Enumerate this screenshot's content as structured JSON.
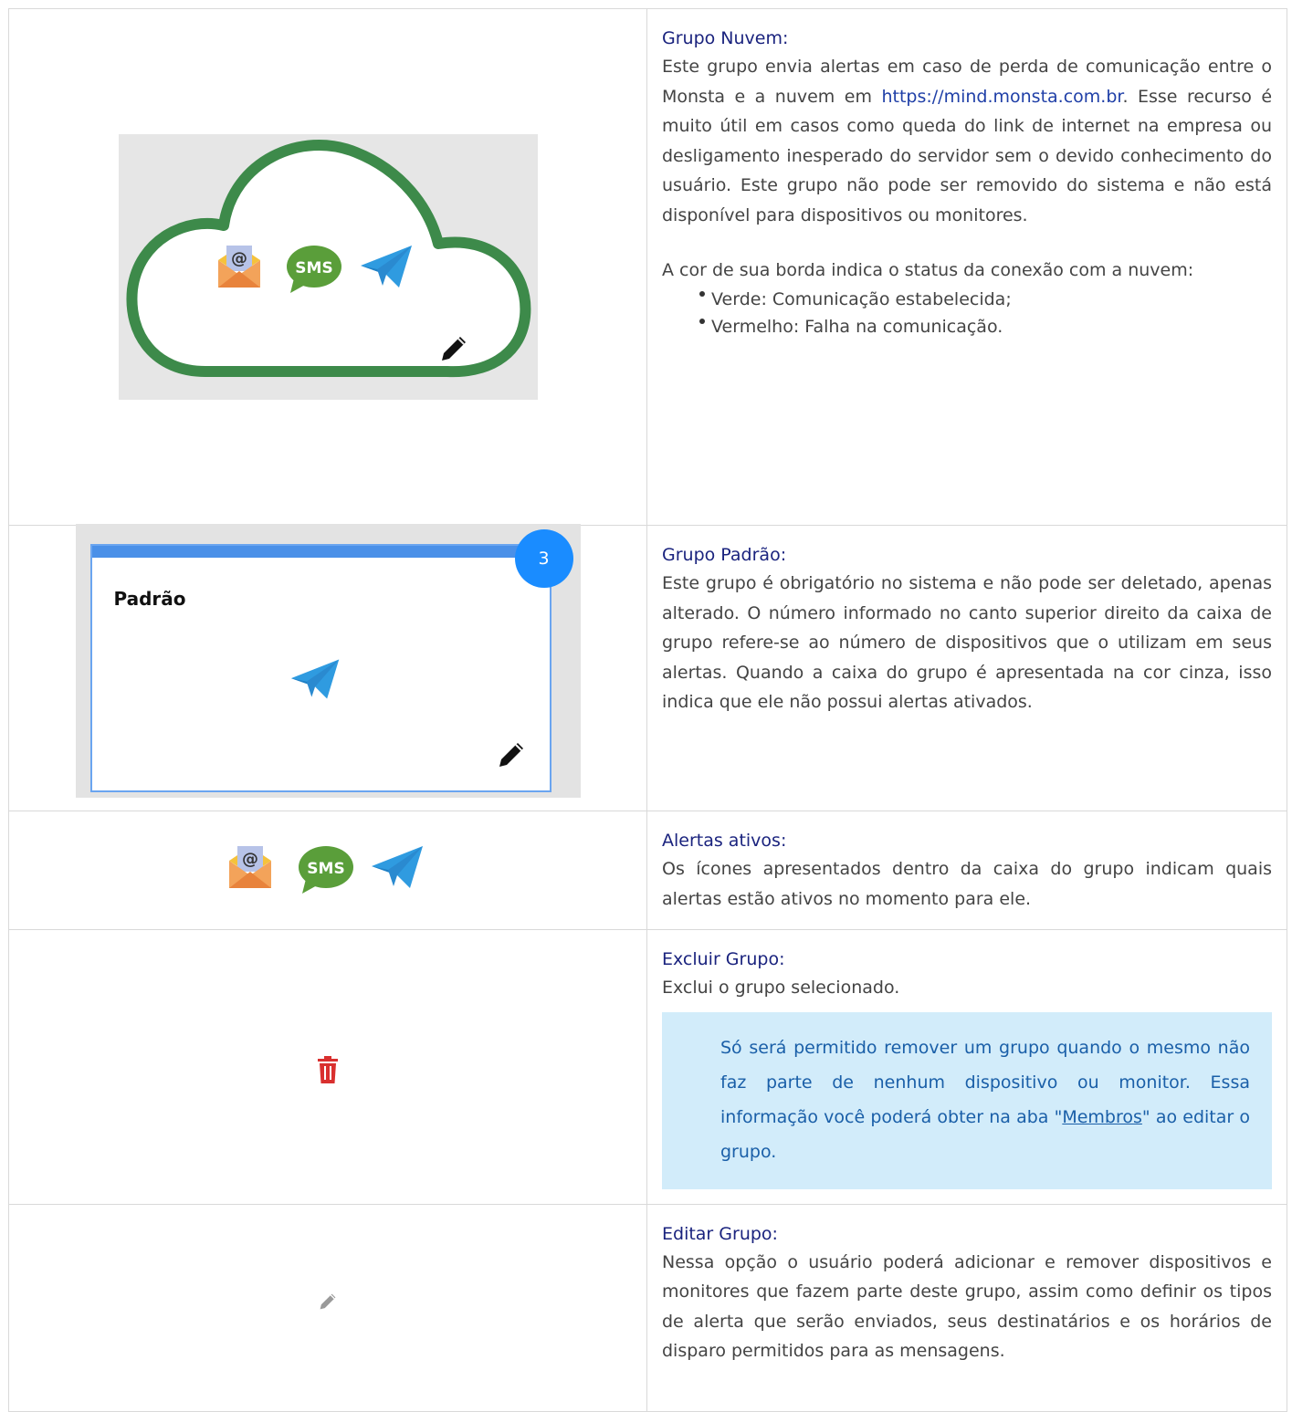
{
  "rows": {
    "nuvem": {
      "heading": "Grupo Nuvem:",
      "p1_before_link": "Este grupo envia alertas em caso de perda de comunicação entre o Monsta e a nuvem em",
      "link": "https://mind.monsta.com.br",
      "p1_after_link": ". Esse recurso é muito útil em casos como queda do link de internet na empresa ou desligamento inesperado do servidor sem o devido conhecimento do usuário. Este grupo não pode ser removido do sistema e não está disponível para dispositivos ou monitores.",
      "p2": "A cor de sua borda indica o status da conexão com a nuvem:",
      "bullets": [
        "Verde: Comunicação estabelecida;",
        "Vermelho: Falha na comunicação."
      ],
      "sms_label": "SMS",
      "cloud_border_color": "#3d8a4a"
    },
    "padrao": {
      "heading": "Grupo Padrão:",
      "text": "Este grupo é obrigatório no sistema e não pode ser deletado, apenas alterado. O número informado no canto superior direito da caixa de grupo refere-se ao número de dispositivos que o utilizam em seus alertas. Quando a caixa do grupo é apresentada na cor cinza, isso indica que ele não possui alertas ativados.",
      "card_title": "Padrão",
      "badge": "3"
    },
    "alertas": {
      "heading": "Alertas ativos:",
      "text": "Os ícones apresentados dentro da caixa do grupo indicam quais alertas estão ativos no momento para ele.",
      "sms_label": "SMS"
    },
    "excluir": {
      "heading": "Excluir Grupo:",
      "text": "Exclui o grupo selecionado.",
      "note_before": "Só será permitido remover um grupo quando o mesmo não faz parte de nenhum dispositivo ou monitor. Essa informação você poderá obter na aba \"",
      "note_link": "Membros",
      "note_after": "\" ao editar o grupo."
    },
    "editar": {
      "heading": "Editar Grupo:",
      "text": "Nessa opção o usuário poderá adicionar e remover dispositivos e monitores que fazem parte deste grupo, assim como definir os tipos de alerta que serão enviados, seus destinatários e os horários de disparo permitidos para as mensagens."
    }
  },
  "icons": {
    "email": "email-envelope-icon",
    "sms": "sms-bubble-icon",
    "telegram": "telegram-plane-icon",
    "edit": "pencil-icon",
    "delete": "trash-icon"
  },
  "colors": {
    "heading": "#1a237e",
    "sms_green": "#5a9e3a",
    "telegram_blue": "#2f9be0",
    "trash_red": "#d9302f",
    "badge_blue": "#1a8cff",
    "note_bg": "#d2ecfa"
  }
}
